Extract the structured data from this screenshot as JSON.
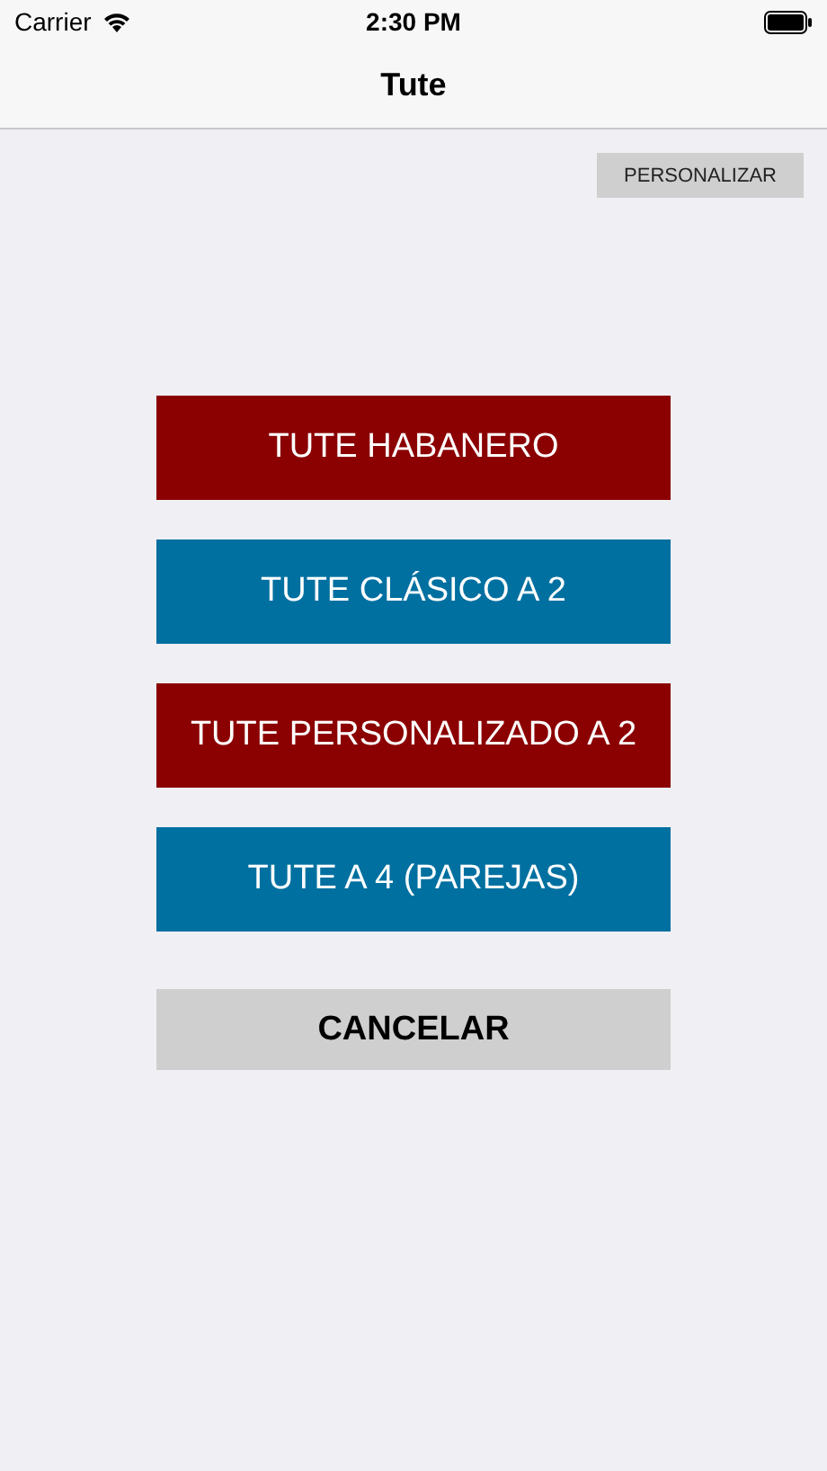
{
  "status_bar": {
    "carrier": "Carrier",
    "time": "2:30 PM"
  },
  "nav": {
    "title": "Tute"
  },
  "customize_button": "PERSONALIZAR",
  "game_buttons": [
    {
      "label": "TUTE HABANERO",
      "color": "#8b0000"
    },
    {
      "label": "TUTE CLÁSICO A 2",
      "color": "#0070a0"
    },
    {
      "label": "TUTE PERSONALIZADO A 2",
      "color": "#8b0000"
    },
    {
      "label": "TUTE A 4 (PAREJAS)",
      "color": "#0070a0"
    }
  ],
  "cancel_button": "CANCELAR"
}
